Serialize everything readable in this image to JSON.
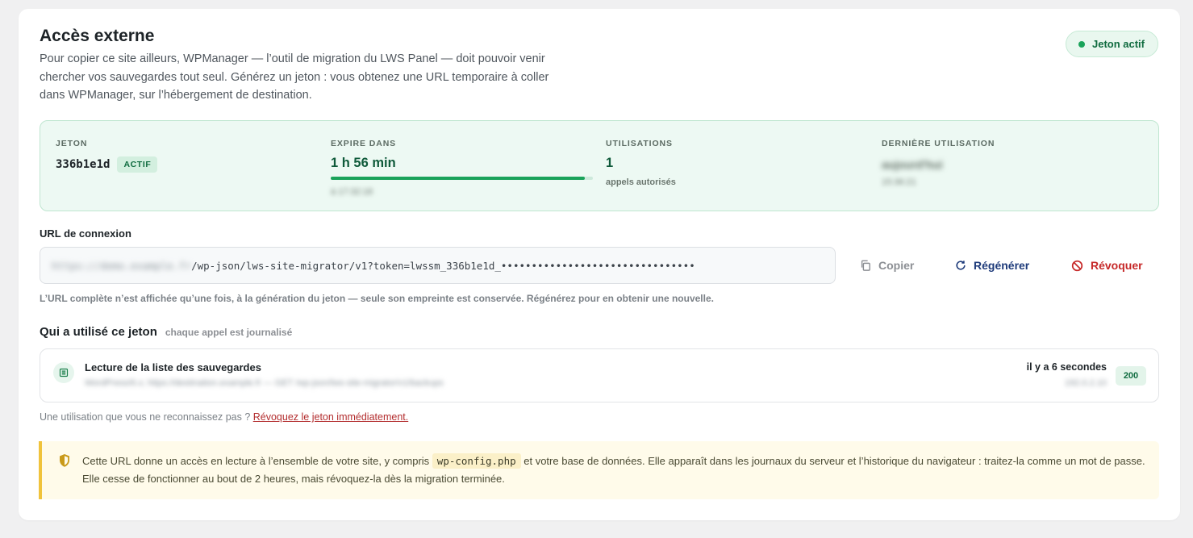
{
  "header": {
    "title": "Accès externe",
    "description": "Pour copier ce site ailleurs, WPManager — l’outil de migration du LWS Panel — doit pouvoir venir chercher vos sauvegardes tout seul. Générez un jeton : vous obtenez une URL temporaire à coller dans WPManager, sur l’hébergement de destination.",
    "status_label": "Jeton actif"
  },
  "token": {
    "label": "JETON",
    "code": "336b1e1d",
    "badge": "ACTIF",
    "expires_label": "EXPIRE DANS",
    "expires_value": "1 h 56 min",
    "expires_progress": 0.97,
    "expires_detail": "à 17:32:18",
    "uses_label": "UTILISATIONS",
    "uses_value": "1",
    "uses_note": "appels autorisés",
    "last_use_label": "DERNIÈRE UTILISATION",
    "last_use_value": "aujourd'hui",
    "last_use_detail": "15:36:21"
  },
  "connection": {
    "label": "URL de connexion",
    "url_hidden_part": "https://demo.example.fr",
    "url_visible_part": "/wp-json/lws-site-migrator/v1?token=lwssm_336b1e1d_••••••••••••••••••••••••••••••••",
    "copy_label": "Copier",
    "regenerate_label": "Régénérer",
    "revoke_label": "Révoquer",
    "note": "L’URL complète n’est affichée qu’une fois, à la génération du jeton — seule son empreinte est conservée. Régénérez pour en obtenir une nouvelle."
  },
  "usage": {
    "title": "Qui a utilisé ce jeton",
    "subtitle": "chaque appel est journalisé",
    "entries": [
      {
        "title": "Lecture de la liste des sauvegardes",
        "detail": "WordPress/6.x; https://destination.example.fr — GET /wp-json/lws-site-migrator/v1/backups",
        "when": "il y a 6 secondes",
        "ip": "192.0.2.10",
        "code": "200"
      }
    ],
    "footer_text": "Une utilisation que vous ne reconnaissez pas ? ",
    "footer_link": "Révoquez le jeton immédiatement."
  },
  "warning": {
    "part1": "Cette URL donne un accès en lecture à l’ensemble de votre site, y compris ",
    "code": "wp-config.php",
    "part2": " et votre base de données. Elle apparaît dans les journaux du serveur et l’historique du navigateur : traitez-la comme un mot de passe. Elle cesse de fonctionner au bout de 2 heures, mais révoquez-la dès la migration terminée."
  },
  "colors": {
    "accent_green": "#1aa35a",
    "token_box_bg": "#edf9f3",
    "regenerate": "#1d3a7a",
    "revoke": "#c62828",
    "warning_border": "#f0c33c"
  },
  "icons": {
    "status": "status-dot-icon",
    "copy": "copy-icon",
    "regenerate": "refresh-icon",
    "revoke": "ban-icon",
    "log": "list-icon",
    "warning": "shield-icon"
  }
}
